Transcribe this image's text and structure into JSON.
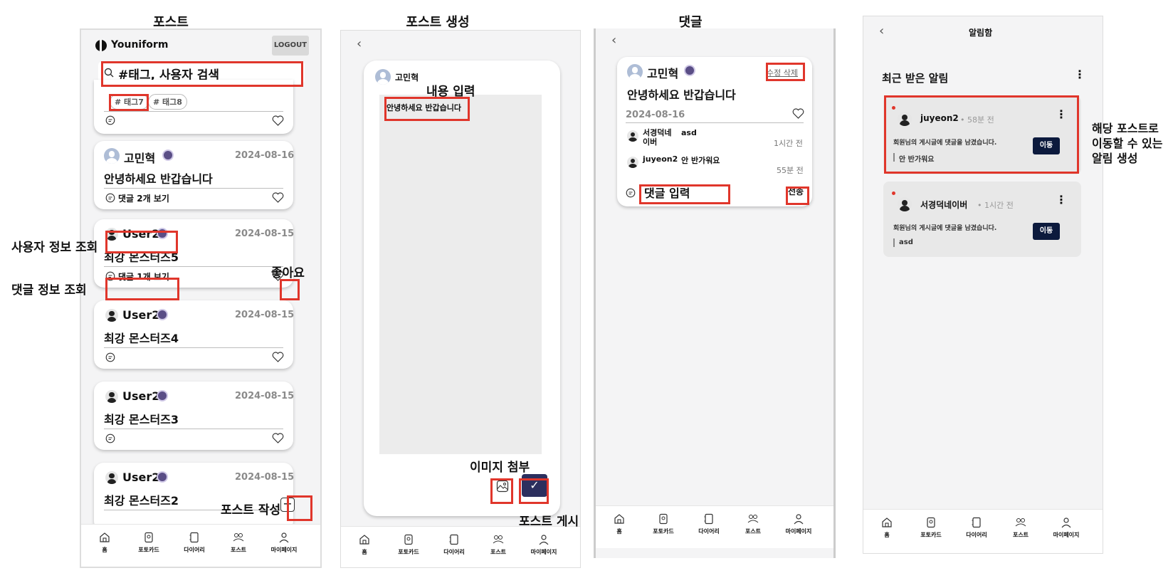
{
  "titles": {
    "feed": "포스트",
    "create": "포스트 생성",
    "comments": "댓글",
    "notifications": "알림함"
  },
  "feed": {
    "brand": "Youniform",
    "logout": "LOGOUT",
    "search_placeholder": "#태그, 사용자 검색",
    "tags": [
      "# 태그7",
      "# 태그8"
    ],
    "posts": [
      {
        "user": "고민혁",
        "date": "2024-08-16",
        "title": "안녕하세요 반갑습니다",
        "comment_link": "댓글 2개 보기"
      },
      {
        "user": "User2",
        "date": "2024-08-15",
        "title": "최강 몬스터즈5",
        "comment_link": "댓글 1개 보기"
      },
      {
        "user": "User2",
        "date": "2024-08-15",
        "title": "최강 몬스터즈4",
        "comment_link": ""
      },
      {
        "user": "User2",
        "date": "2024-08-15",
        "title": "최강 몬스터즈3",
        "comment_link": ""
      },
      {
        "user": "User2",
        "date": "2024-08-15",
        "title": "최강 몬스터즈2",
        "comment_link": ""
      }
    ]
  },
  "create": {
    "user": "고민혁",
    "content": "안녕하세요 반갑습니다"
  },
  "comments": {
    "user": "고민혁",
    "actions": "수정 삭제",
    "title": "안녕하세요 반갑습니다",
    "date": "2024-08-16",
    "items": [
      {
        "user": "서경덕네 이버",
        "text": "asd",
        "time": "1시간 전"
      },
      {
        "user": "juyeon2",
        "text": "안 반가워요",
        "time": "55분 전"
      }
    ],
    "input_placeholder": "댓글 입력",
    "send": "전송"
  },
  "notifications": {
    "title": "알림함",
    "section": "최근 받은 알림",
    "items": [
      {
        "user": "juyeon2",
        "time": "• 58분 전",
        "message": "회원님의 게시글에 댓글을 남겼습니다.",
        "quote": "안 반가워요",
        "button": "이동"
      },
      {
        "user": "서경덕네이버",
        "time": "• 1시간 전",
        "message": "회원님의 게시글에 댓글을 남겼습니다.",
        "quote": "asd",
        "button": "이동"
      }
    ]
  },
  "nav": [
    "홈",
    "포토카드",
    "다이어리",
    "포스트",
    "마이페이지"
  ],
  "annotations": {
    "user_info": "사용자 정보 조회",
    "comment_info": "댓글 정보 조회",
    "like": "좋아요",
    "write_post": "포스트 작성",
    "content_input": "내용 입력",
    "image_attach": "이미지 첨부",
    "post_publish": "포스트 게시",
    "notif_note": [
      "해당 포스트로",
      "이동할 수 있는",
      "알림 생성"
    ]
  },
  "colors": {
    "highlight": "#e0362b",
    "primary_dark": "#2c2f5e",
    "move_button": "#0c1a3d",
    "unread_dot": "#e0362b"
  }
}
